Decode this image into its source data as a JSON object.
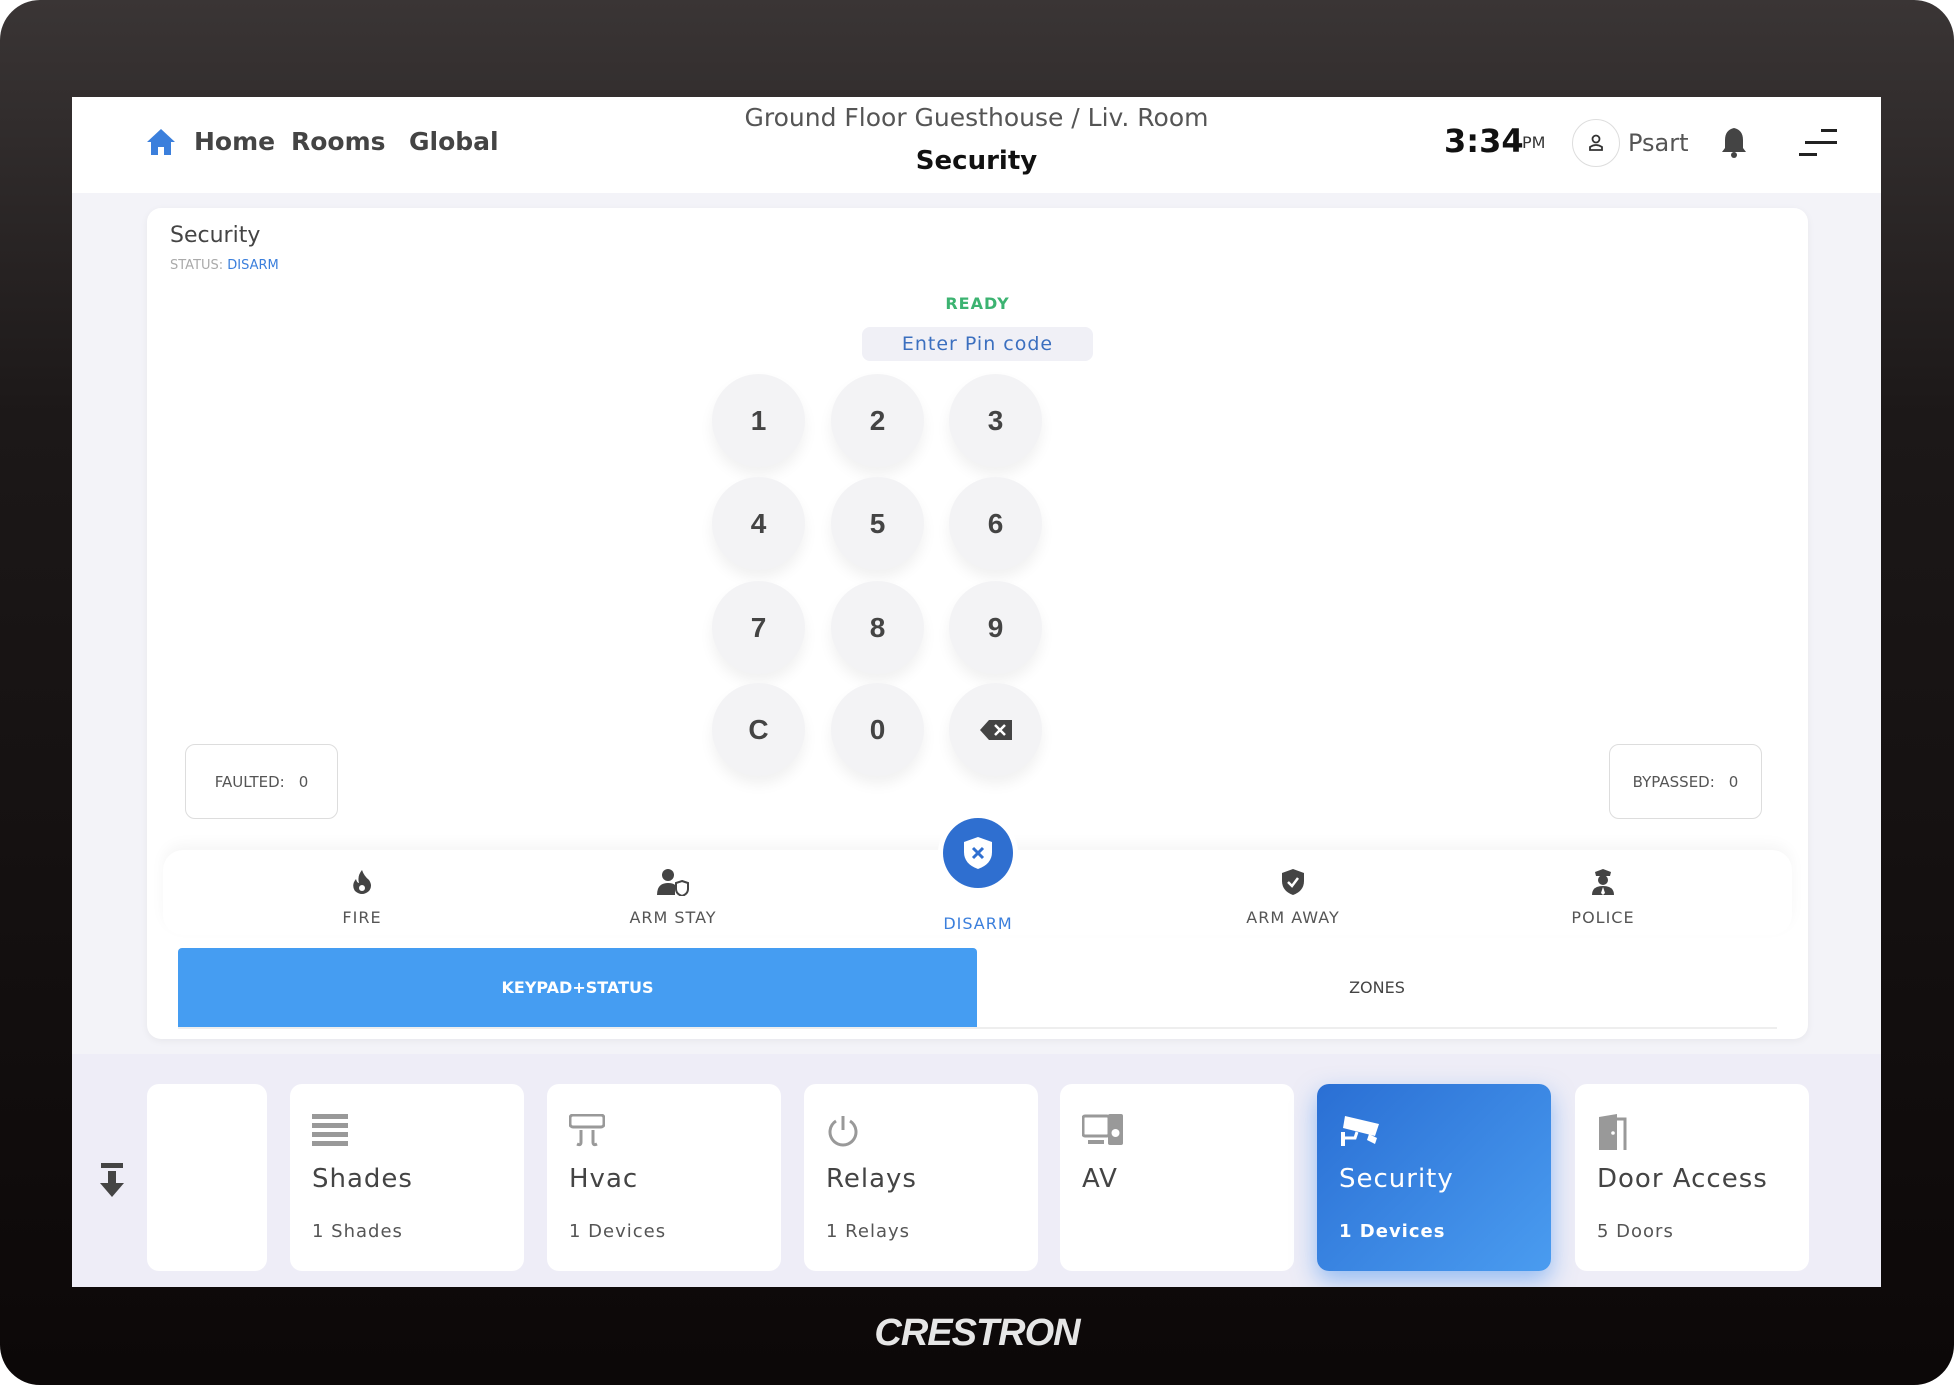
{
  "header": {
    "nav": [
      "Home",
      "Rooms",
      "Global"
    ],
    "breadcrumb": "Ground Floor Guesthouse / Liv. Room",
    "title": "Security",
    "time": "3:34",
    "ampm": "PM",
    "user": "Psart"
  },
  "panel": {
    "title": "Security",
    "status_label": "STATUS:",
    "status_value": "DISARM",
    "ready": "READY",
    "pin_placeholder": "Enter Pin code",
    "keys": [
      "1",
      "2",
      "3",
      "4",
      "5",
      "6",
      "7",
      "8",
      "9",
      "C",
      "0"
    ],
    "faulted_label": "FAULTED:",
    "faulted_value": "0",
    "bypassed_label": "BYPASSED:",
    "bypassed_value": "0"
  },
  "modes": [
    {
      "label": "FIRE",
      "icon": "fire-icon"
    },
    {
      "label": "ARM STAY",
      "icon": "person-shield-icon"
    },
    {
      "label": "DISARM",
      "icon": "shield-x-icon",
      "active": true
    },
    {
      "label": "ARM AWAY",
      "icon": "shield-check-icon"
    },
    {
      "label": "POLICE",
      "icon": "police-icon"
    }
  ],
  "tabs": [
    {
      "label": "KEYPAD+STATUS",
      "active": true
    },
    {
      "label": "ZONES"
    }
  ],
  "tiles": [
    {
      "title": "Shades",
      "sub": "1 Shades",
      "icon": "shades-icon"
    },
    {
      "title": "Hvac",
      "sub": "1 Devices",
      "icon": "hvac-icon"
    },
    {
      "title": "Relays",
      "sub": "1 Relays",
      "icon": "power-icon"
    },
    {
      "title": "AV",
      "sub": "",
      "icon": "av-icon"
    },
    {
      "title": "Security",
      "sub": "1 Devices",
      "icon": "camera-icon",
      "active": true
    },
    {
      "title": "Door Access",
      "sub": "5 Doors",
      "icon": "door-icon"
    }
  ],
  "brand": "CRESTRON",
  "colors": {
    "accent": "#3b7fdc",
    "tab_active": "#459df2",
    "ready": "#3cb371",
    "status": "#3b7fdc"
  }
}
